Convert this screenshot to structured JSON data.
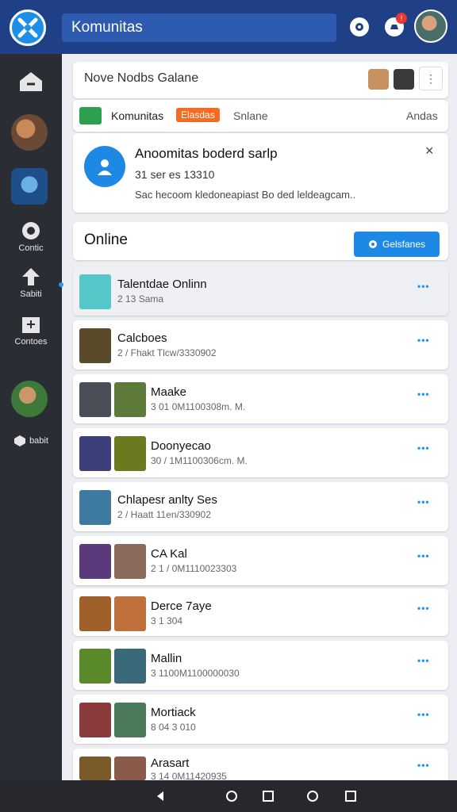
{
  "header": {
    "title": "Komunitas",
    "notification_count": "!",
    "colors": {
      "bar": "#1f3f86",
      "accent": "#1d8fe8"
    }
  },
  "sidebar": {
    "items": [
      {
        "icon": "home-icon",
        "label": ""
      },
      {
        "icon": "game-avatar",
        "label": ""
      },
      {
        "icon": "game-avatar",
        "label": ""
      },
      {
        "icon": "controller-icon",
        "label": "Contic"
      },
      {
        "icon": "upload-icon",
        "label": "Sabiti"
      },
      {
        "icon": "box-icon",
        "label": "Contoes"
      },
      {
        "icon": "game-avatar",
        "label": ""
      },
      {
        "icon": "cube-icon",
        "label": "babit"
      }
    ]
  },
  "composer": {
    "placeholder": "Nove Nodbs Galane",
    "more": "⋮"
  },
  "tabs": [
    {
      "label": "Komunitas"
    },
    {
      "label": "Elasdas"
    },
    {
      "label": "Snlane"
    },
    {
      "label": "Andas"
    }
  ],
  "promo": {
    "title": "Anoomitas boderd sarlp",
    "subtitle": "31 ser es 13310",
    "description": "Sac hecoom kledoneapiast Bo ded leldeagcam..",
    "close": "×"
  },
  "online": {
    "title": "Online",
    "button_label": "Gelsfanes"
  },
  "games": [
    {
      "name": "Talentdae Onlinn",
      "meta": "2 13 Sama",
      "highlighted": true
    },
    {
      "name": "Calcboes",
      "meta": "2 / Fhakt Tlcw/3330902"
    },
    {
      "name": "Maake",
      "meta": "3 01 0M1100308m. M."
    },
    {
      "name": "Doonyecao",
      "meta": "30 / 1M1100306cm. M."
    },
    {
      "name": "Chlapesr anlty Ses",
      "meta": "2 / Haatt 11en/330902"
    },
    {
      "name": "CA Kal",
      "meta": "2 1 / 0M1110023303"
    },
    {
      "name": "Derce 7aye",
      "meta": "3 1 304"
    },
    {
      "name": "Mallin",
      "meta": "3 1100M1100000030"
    },
    {
      "name": "Mortiack",
      "meta": "8 04 3 010"
    },
    {
      "name": "Arasart",
      "meta": "3 14 0M11420935"
    }
  ],
  "row_action": "•••"
}
